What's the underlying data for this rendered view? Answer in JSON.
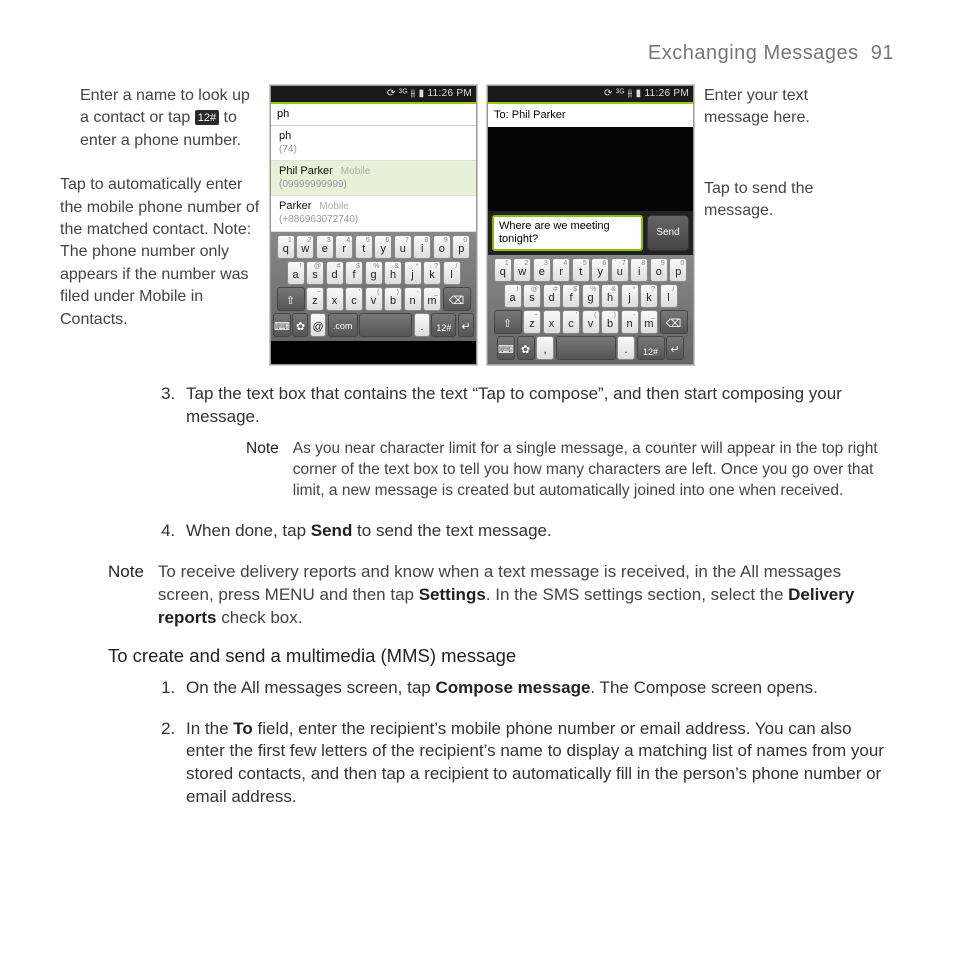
{
  "header": {
    "title": "Exchanging Messages",
    "page_no": "91"
  },
  "icon12": "12#",
  "callouts": {
    "left1a": "Enter a name to look up a contact or tap ",
    "left1b": " to enter a phone number.",
    "left2": "Tap to automatically enter the mobile phone number of the matched contact. Note: The phone number only appears if the number was filed under Mobile in Contacts.",
    "right1": "Enter your text message here.",
    "right2": "Tap to send the message."
  },
  "status_time": "11:26 PM",
  "status_icons": "⟳ ³ᴳ ⫵ ▮ ",
  "phone1": {
    "search": "ph",
    "contacts": [
      {
        "name": "ph",
        "num": "(74)"
      },
      {
        "name": "Phil Parker",
        "type": "Mobile",
        "num": "(09999999999)",
        "sel": true
      },
      {
        "name": "Parker",
        "type": "Mobile",
        "num": "(+886963072740)"
      }
    ]
  },
  "phone2": {
    "to": "To: Phil Parker",
    "compose": "Where are we meeting tonight?",
    "send": "Send"
  },
  "keyboard": {
    "row1": [
      [
        "q",
        "1"
      ],
      [
        "w",
        "2"
      ],
      [
        "e",
        "3"
      ],
      [
        "r",
        "4"
      ],
      [
        "t",
        "5"
      ],
      [
        "y",
        "6"
      ],
      [
        "u",
        "7"
      ],
      [
        "i",
        "8"
      ],
      [
        "o",
        "9"
      ],
      [
        "p",
        "0"
      ]
    ],
    "row2": [
      [
        "a",
        "!"
      ],
      [
        "s",
        "@"
      ],
      [
        "d",
        "#"
      ],
      [
        "f",
        "$"
      ],
      [
        "g",
        "%"
      ],
      [
        "h",
        "&"
      ],
      [
        "j",
        "*"
      ],
      [
        "k",
        "?"
      ],
      [
        "l",
        "/"
      ]
    ],
    "row3": [
      [
        "⇧",
        ""
      ],
      [
        "z",
        "~"
      ],
      [
        "x",
        ""
      ],
      [
        "c",
        "'"
      ],
      [
        "v",
        "("
      ],
      [
        "b",
        ")"
      ],
      [
        "n",
        "-"
      ],
      [
        "m",
        "_"
      ],
      [
        "⌫",
        ""
      ]
    ],
    "row4": [
      "⌨",
      "✿",
      "@",
      ".com",
      "␣",
      ".",
      "12#",
      "↵"
    ],
    "row4b": [
      "⌨",
      "✿",
      ",",
      "␣",
      ".",
      "12#",
      "↵"
    ]
  },
  "body": {
    "step3": "Tap the text box that contains the text “Tap to compose”, and then start composing your message.",
    "step3_note_label": "Note",
    "step3_note": "As you near character limit for a single message, a counter will appear in the top right corner of the text box to tell you how many characters are left. Once you go over that limit, a new message is created but automatically joined into one when received.",
    "step4a": "When done, tap ",
    "step4b": "Send",
    "step4c": " to send the text message.",
    "page_note_label": "Note",
    "page_note_a": "To receive delivery reports and know when a text message is received, in the All messages screen, press MENU and then tap ",
    "page_note_b": "Settings",
    "page_note_c": ". In the SMS settings section, select the ",
    "page_note_d": "Delivery reports",
    "page_note_e": " check box.",
    "mms_heading": "To create and send a multimedia (MMS) message",
    "mms1a": "On the All messages screen, tap ",
    "mms1b": "Compose message",
    "mms1c": ". The Compose screen opens.",
    "mms2a": "In the ",
    "mms2b": "To",
    "mms2c": " field, enter the recipient’s mobile phone number or email address. You can also enter the first few letters of the recipient’s name to display a matching list of names from your stored contacts, and then tap a recipient to automatically fill in the person’s phone number or email address."
  }
}
